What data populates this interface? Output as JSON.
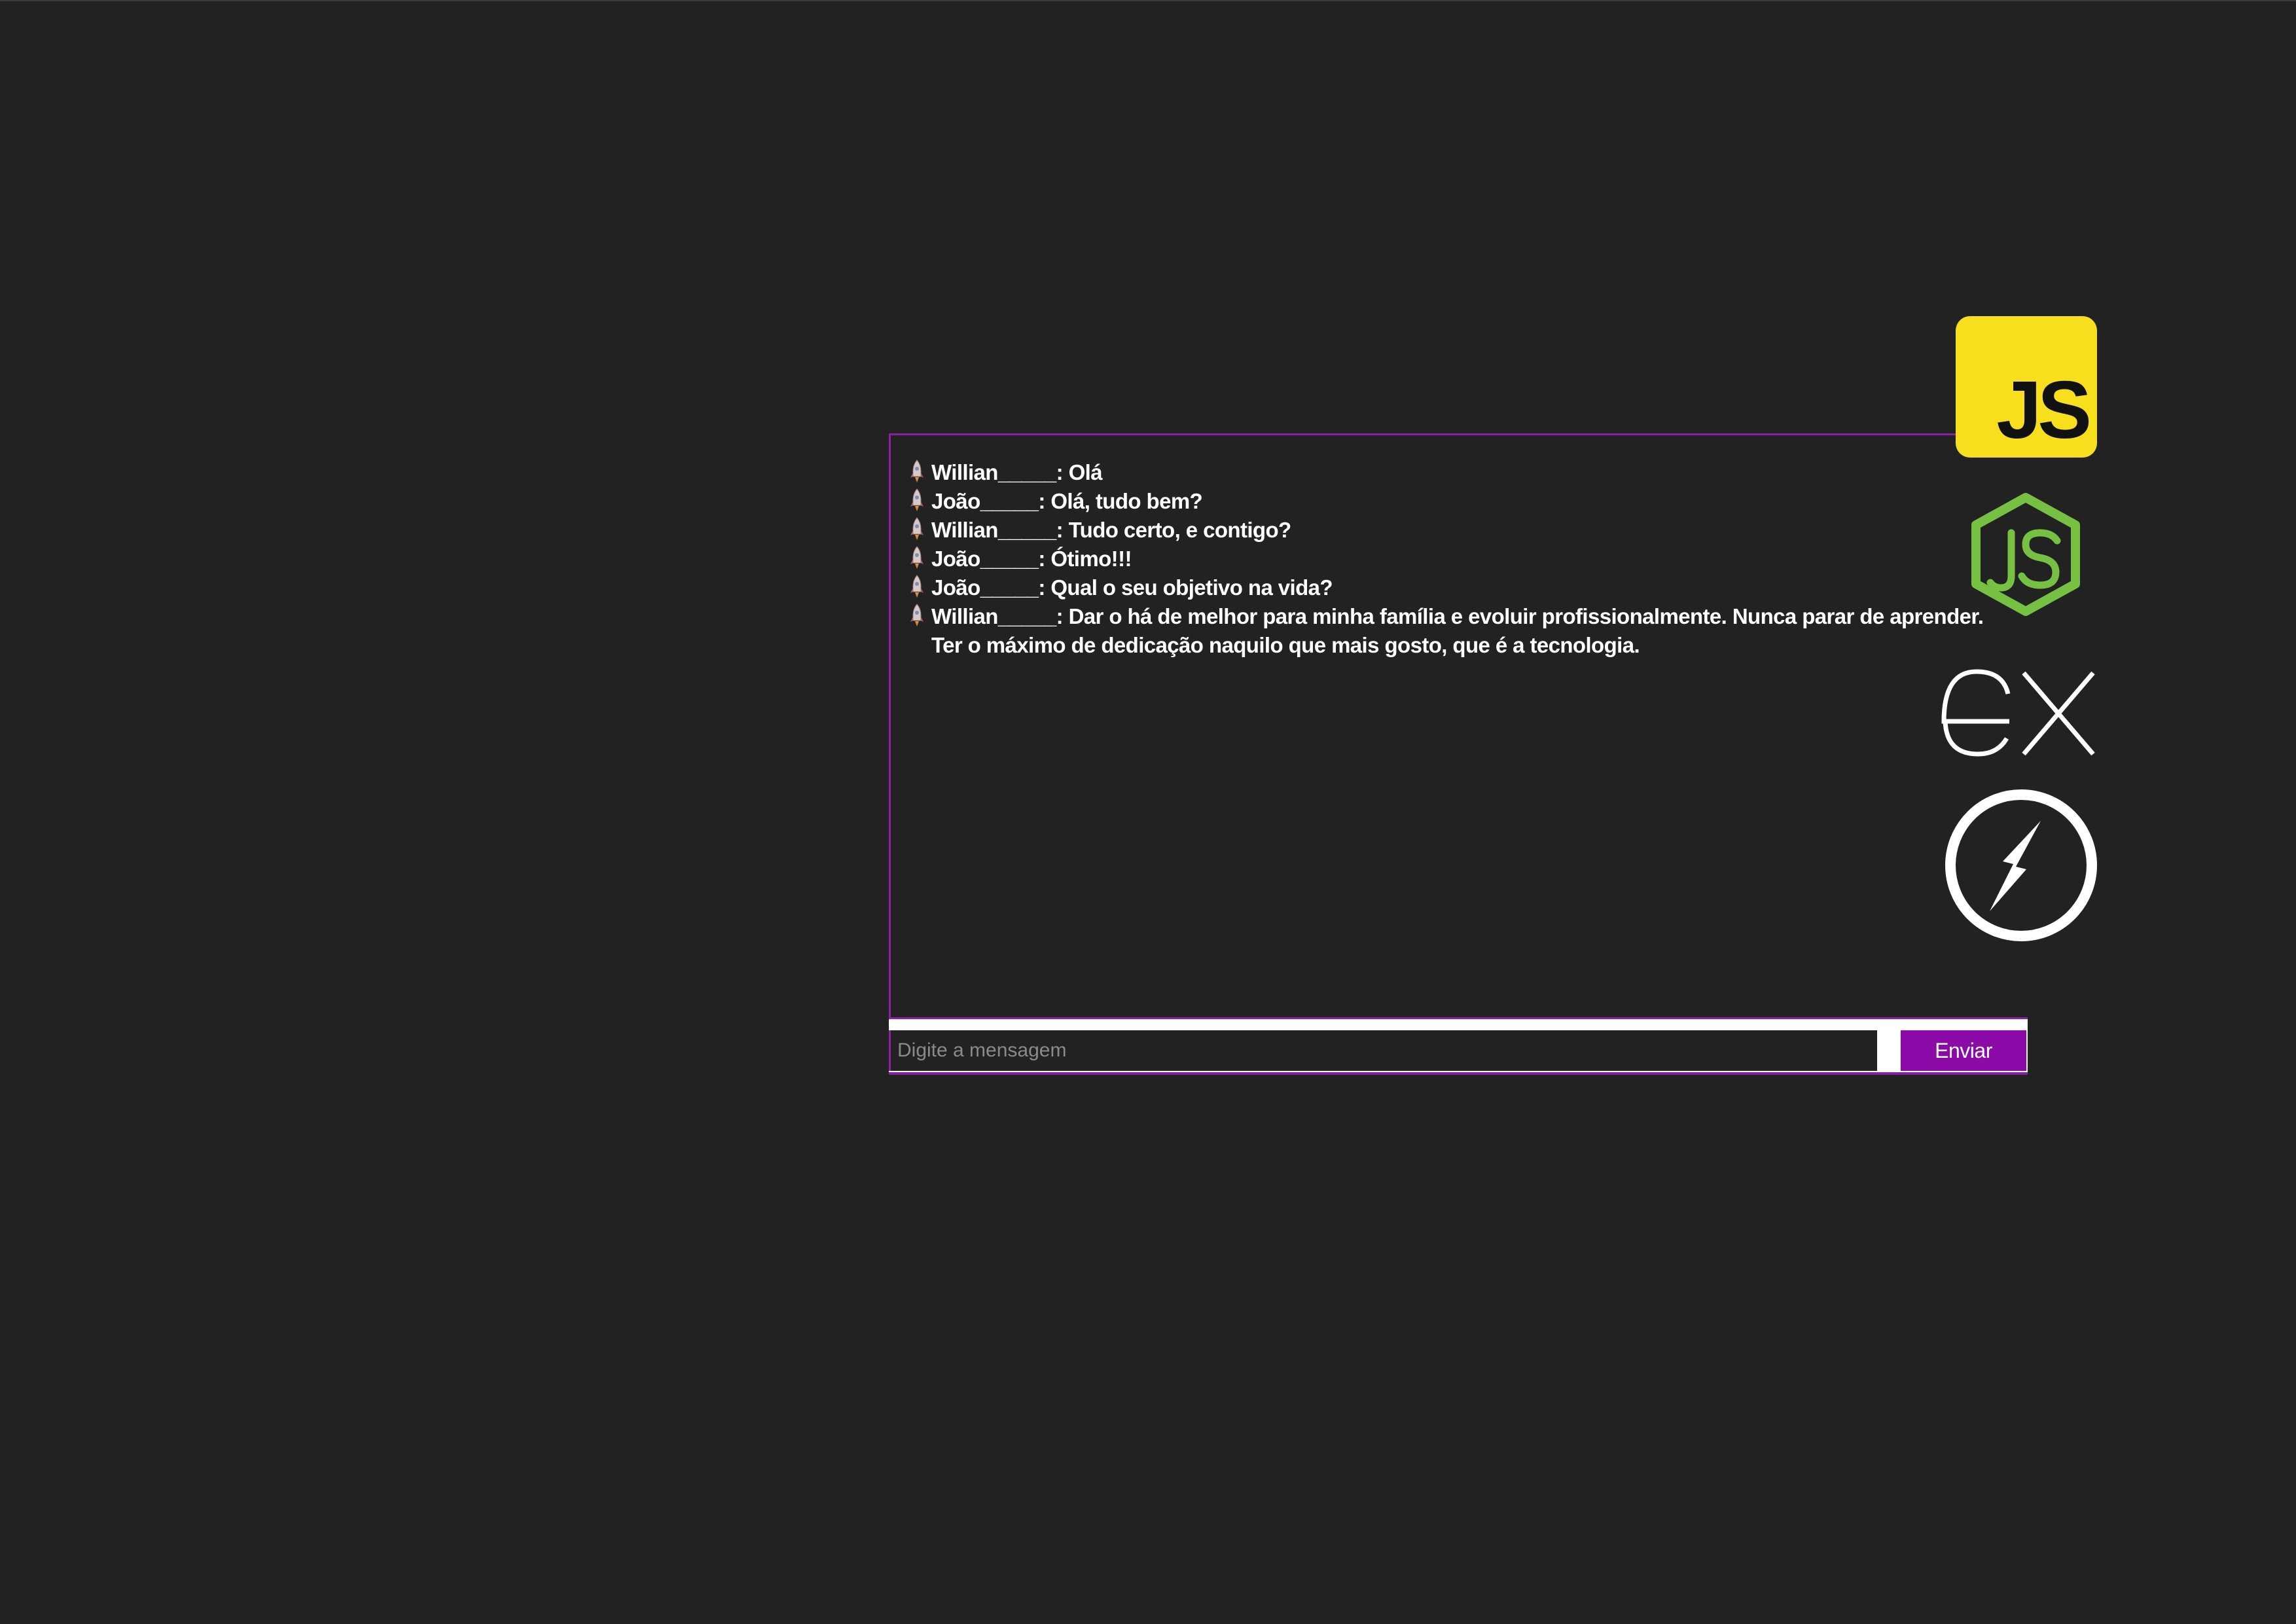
{
  "chat": {
    "messages": [
      {
        "user": "Willian_____",
        "text": "Olá"
      },
      {
        "user": "João_____",
        "text": "Olá, tudo bem?"
      },
      {
        "user": "Willian_____",
        "text": "Tudo certo, e contigo?"
      },
      {
        "user": "João_____",
        "text": "Ótimo!!!"
      },
      {
        "user": "João_____",
        "text": "Qual o seu objetivo na vida?"
      },
      {
        "user": "Willian_____",
        "text": "Dar o há de melhor para minha família e evoluir profissionalmente. Nunca parar de aprender. Ter o máximo de dedicação naquilo que mais gosto, que é a tecnologia."
      }
    ],
    "bullet_icon": "rocket-icon"
  },
  "input": {
    "placeholder": "Digite a mensagem",
    "value": ""
  },
  "send_button": {
    "label": "Enviar"
  },
  "logos": {
    "javascript": {
      "text": "JS",
      "icon": "javascript-logo",
      "color": "#f7df1e"
    },
    "nodejs": {
      "icon": "nodejs-logo",
      "color": "#76c043"
    },
    "express": {
      "icon": "express-logo",
      "color": "#ffffff"
    },
    "socketio": {
      "icon": "socketio-logo",
      "color": "#ffffff"
    }
  },
  "colors": {
    "background": "#222222",
    "accent": "#8a1fa8",
    "button": "#8b0aa8"
  }
}
